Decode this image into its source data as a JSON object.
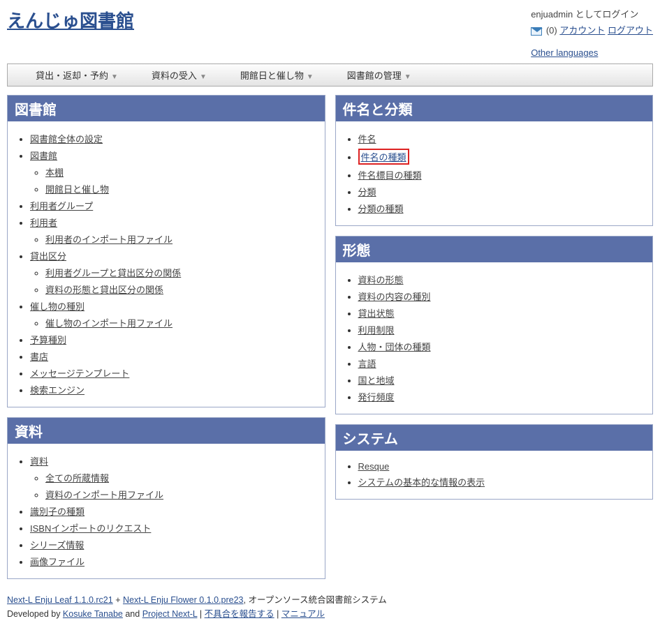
{
  "header": {
    "title": "えんじゅ図書館",
    "user_line": "enjuadmin としてログイン",
    "msg_count": "(0)",
    "account": "アカウント",
    "logout": "ログアウト",
    "other_languages": "Other languages"
  },
  "menu": {
    "items": [
      "貸出・返却・予約",
      "資料の受入",
      "開館日と催し物",
      "図書館の管理"
    ]
  },
  "left_panels": [
    {
      "title": "図書館",
      "items": [
        {
          "label": "図書館全体の設定"
        },
        {
          "label": "図書館",
          "sub": [
            "本棚",
            "開館日と催し物"
          ]
        },
        {
          "label": "利用者グループ"
        },
        {
          "label": "利用者",
          "sub": [
            "利用者のインポート用ファイル"
          ]
        },
        {
          "label": "貸出区分",
          "sub": [
            "利用者グループと貸出区分の関係",
            "資料の形態と貸出区分の関係"
          ]
        },
        {
          "label": "催し物の種別",
          "sub": [
            "催し物のインポート用ファイル"
          ]
        },
        {
          "label": "予算種別"
        },
        {
          "label": "書店"
        },
        {
          "label": "メッセージテンプレート"
        },
        {
          "label": "検索エンジン"
        }
      ]
    },
    {
      "title": "資料",
      "items": [
        {
          "label": "資料",
          "sub": [
            "全ての所蔵情報",
            "資料のインポート用ファイル"
          ]
        },
        {
          "label": "識別子の種類"
        },
        {
          "label": "ISBNインポートのリクエスト"
        },
        {
          "label": "シリーズ情報"
        },
        {
          "label": "画像ファイル"
        }
      ]
    }
  ],
  "right_panels": [
    {
      "title": "件名と分類",
      "items": [
        {
          "label": "件名"
        },
        {
          "label": "件名の種類",
          "highlight": true
        },
        {
          "label": "件名標目の種類"
        },
        {
          "label": "分類"
        },
        {
          "label": "分類の種類"
        }
      ]
    },
    {
      "title": "形態",
      "items": [
        {
          "label": "資料の形態"
        },
        {
          "label": "資料の内容の種別"
        },
        {
          "label": "貸出状態"
        },
        {
          "label": "利用制限"
        },
        {
          "label": "人物・団体の種類"
        },
        {
          "label": "言語"
        },
        {
          "label": "国と地域"
        },
        {
          "label": "発行頻度"
        }
      ]
    },
    {
      "title": "システム",
      "items": [
        {
          "label": "Resque"
        },
        {
          "label": "システムの基本的な情報の表示"
        }
      ]
    }
  ],
  "footer": {
    "leaf": "Next-L Enju Leaf 1.1.0.rc21",
    "plus": " + ",
    "flower": "Next-L Enju Flower 0.1.0.pre23",
    "tagline": ", オープンソース統合図書館システム",
    "dev_by": "Developed by ",
    "dev_name": "Kosuke Tanabe",
    "and": " and ",
    "project": "Project Next-L",
    "sep": " | ",
    "report": "不具合を報告する",
    "manual": "マニュアル"
  }
}
